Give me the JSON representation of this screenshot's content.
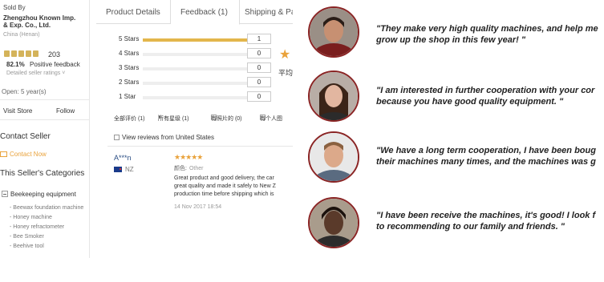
{
  "seller": {
    "sold_by": "Sold By",
    "company_line1": "Zhengzhou Known Imp.",
    "company_line2": "& Exp. Co., Ltd.",
    "location": "China (Henan)",
    "score": "203",
    "positive_pct": "82.1%",
    "positive_label": "Positive feedback",
    "detailed_ratings": "Detailed seller ratings",
    "open_years": "Open: 5 year(s)",
    "visit_store": "Visit Store",
    "follow": "Follow",
    "contact_heading": "Contact Seller",
    "contact_now": "Contact Now",
    "categories_heading": "This Seller's Categories",
    "category_parent": "Beekeeping equipment",
    "categories": [
      "- Beewax foundation machine",
      "- Honey machine",
      "- Honey refractometer",
      "- Bee Smoker",
      "- Beehive tool"
    ]
  },
  "feedback": {
    "tabs": {
      "details": "Product Details",
      "feedback": "Feedback (1)",
      "shipping": "Shipping & Pa"
    },
    "star_rows": [
      {
        "label": "5 Stars",
        "count": "1",
        "fill": 1.0
      },
      {
        "label": "4 Stars",
        "count": "0",
        "fill": 0
      },
      {
        "label": "3 Stars",
        "count": "0",
        "fill": 0
      },
      {
        "label": "2 Stars",
        "count": "0",
        "fill": 0
      },
      {
        "label": "1 Star",
        "count": "0",
        "fill": 0
      }
    ],
    "average_cn": "平均",
    "filters": {
      "all": "全部评价 (1)",
      "all_stars": "所有星级 (1)",
      "with_photos": "有照片的 (0)",
      "personal": "有个人图"
    },
    "us_only": "View reviews from United States",
    "review": {
      "reviewer": "A***n",
      "country": "NZ",
      "stars": "★★★★★",
      "color_label": "颜色:",
      "color_value": "Other",
      "text_lines": [
        "Great product and good delivery, the car",
        "great quality and made it safely to New Z",
        "production time before shipping which is"
      ],
      "date": "14 Nov 2017 18:54"
    }
  },
  "testimonials": [
    {
      "line1": "\"They make very high quality machines, and help me",
      "line2": "grow up the shop in this few year! \"",
      "skin": "#c79072",
      "hair": "#2a1d17",
      "shirt": "#7a1e1e"
    },
    {
      "line1": "\"I am interested in further cooperation with your cor",
      "line2": "because you have good quality equipment. \"",
      "skin": "#e2b6a0",
      "hair": "#3b2418",
      "shirt": "#2b2b2b"
    },
    {
      "line1": "\"We have a long term cooperation, I have been boug",
      "line2": "their machines many times, and the machines was g",
      "skin": "#dca98a",
      "hair": "#8a6140",
      "shirt": "#5a6b80"
    },
    {
      "line1": "\"I have been receive the machines, it's good! I look f",
      "line2": "to recommending to our family and friends. \"",
      "skin": "#5a3a2a",
      "hair": "#1c120d",
      "shirt": "#2c2c2c"
    }
  ]
}
